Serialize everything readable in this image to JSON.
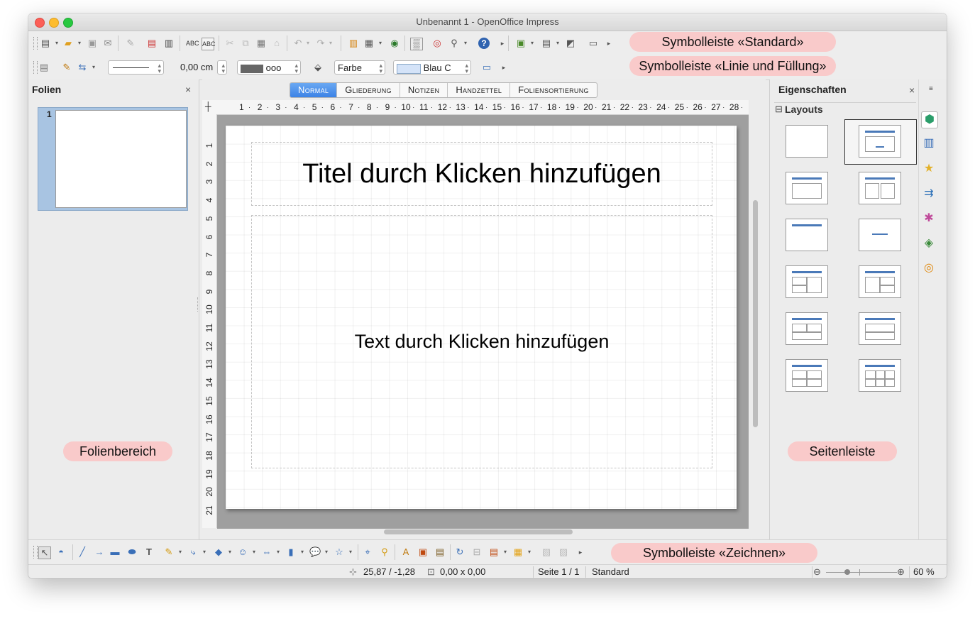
{
  "window": {
    "title": "Unbenannt 1 - OpenOffice Impress"
  },
  "callouts": {
    "standard": "Symbolleiste «Standard»",
    "line_fill": "Symbolleiste «Linie und Füllung»",
    "slides": "Folienbereich",
    "sidebar": "Seitenleiste",
    "drawing": "Symbolleiste «Zeichnen»"
  },
  "line_fill_toolbar": {
    "line_width": "0,00 cm",
    "line_color": "ooo",
    "area_style": "Farbe",
    "area_color": "Blau C"
  },
  "slides_pane": {
    "title": "Folien",
    "close": "×",
    "slide_number": "1"
  },
  "view_tabs": [
    "Normal",
    "Gliederung",
    "Notizen",
    "Handzettel",
    "Foliensortierung"
  ],
  "hruler_numbers": [
    "1",
    "2",
    "3",
    "4",
    "5",
    "6",
    "7",
    "8",
    "9",
    "10",
    "11",
    "12",
    "13",
    "14",
    "15",
    "16",
    "17",
    "18",
    "19",
    "20",
    "21",
    "22",
    "23",
    "24",
    "25",
    "26",
    "27",
    "28"
  ],
  "vruler_numbers": [
    "1",
    "2",
    "3",
    "4",
    "5",
    "6",
    "7",
    "8",
    "9",
    "10",
    "11",
    "12",
    "13",
    "14",
    "15",
    "16",
    "17",
    "18",
    "19",
    "20",
    "21"
  ],
  "slide": {
    "title_placeholder": "Titel durch Klicken hinzufügen",
    "text_placeholder": "Text durch Klicken hinzufügen"
  },
  "properties_panel": {
    "title": "Eigenschaften",
    "close": "×",
    "section": "Layouts",
    "section_toggle": "⊟"
  },
  "status": {
    "position": "25,87 / -1,28",
    "size": "0,00 x 0,00",
    "page": "Seite 1 / 1",
    "master": "Standard",
    "zoom": "60 %",
    "zoom_level": 0.6
  },
  "icons": {
    "standard_toolbar": [
      "new-icon",
      "open-icon",
      "save-icon",
      "email-icon",
      "edit-file-icon",
      "pdf-export-icon",
      "print-icon",
      "spellcheck-icon",
      "autospellcheck-icon",
      "cut-icon",
      "copy-icon",
      "paste-icon",
      "clone-format-icon",
      "undo-icon",
      "redo-icon",
      "chart-icon",
      "table-icon",
      "display-grid-icon",
      "grid-icon",
      "navigator-icon",
      "zoom-icon",
      "help-icon",
      "slide-add-icon",
      "slide-layout-icon",
      "slide-design-icon",
      "slideshow-icon"
    ],
    "drawing_toolbar": [
      "select-icon",
      "curve-icon",
      "line-icon",
      "arrow-icon",
      "rectangle-icon",
      "ellipse-icon",
      "text-icon",
      "curve-tool-icon",
      "connector-icon",
      "basic-shapes-icon",
      "symbol-shapes-icon",
      "block-arrows-icon",
      "flowchart-icon",
      "callouts-icon",
      "stars-icon",
      "points-icon",
      "glue-points-icon",
      "fontwork-icon",
      "from-file-icon",
      "gallery-icon",
      "rotate-icon",
      "align-icon",
      "arrange-icon",
      "extrusion-icon",
      "shadow-icon"
    ]
  }
}
